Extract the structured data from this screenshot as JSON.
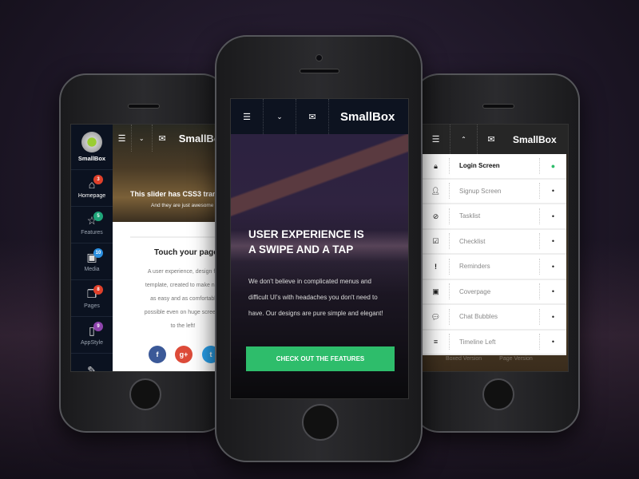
{
  "brand": "SmallBox",
  "left_phone": {
    "header": {
      "menu_icon": "hamburger-icon",
      "dropdown_icon": "chevron-down-icon",
      "mail_icon": "envelope-icon",
      "brand": "SmallBox"
    },
    "sidebar": {
      "logo_label": "SmallBox",
      "items": [
        {
          "label": "Homepage",
          "icon": "home-icon",
          "badge": "3",
          "badge_color": "#e0402a"
        },
        {
          "label": "Features",
          "icon": "star-icon",
          "badge": "5",
          "badge_color": "#1fa67a"
        },
        {
          "label": "Media",
          "icon": "image-icon",
          "badge": "10",
          "badge_color": "#2b8fe0"
        },
        {
          "label": "Pages",
          "icon": "pages-icon",
          "badge": "8",
          "badge_color": "#e0402a"
        },
        {
          "label": "AppStyle",
          "icon": "phone-icon",
          "badge": "9",
          "badge_color": "#8e44ad"
        }
      ]
    },
    "slider": {
      "title": "This slider has CSS3 tran",
      "subtitle": "And they are just awesome"
    },
    "content": {
      "heading": "Touch your page",
      "body": [
        "A user experience, design fo",
        "template, created to make nav",
        "as easy and as comfortabl",
        "possible even on huge screens",
        "to the left!"
      ]
    },
    "social": [
      {
        "label": "f",
        "color": "#3b5998"
      },
      {
        "label": "g+",
        "color": "#dd4b39"
      },
      {
        "label": "t",
        "color": "#2aa1ec"
      }
    ]
  },
  "center_phone": {
    "header": {
      "brand": "SmallBox"
    },
    "hero": {
      "title_line1": "USER EXPERIENCE IS",
      "title_line2": "A SWIPE AND A TAP",
      "body": [
        "We don't believe in complicated menus and",
        "difficult UI's with headaches you don't need to",
        "have. Our designs are pure simple and elegant!"
      ]
    },
    "cta": {
      "label": "CHECK OUT THE FEATURES",
      "color": "#2ebd6b"
    }
  },
  "right_phone": {
    "header": {
      "brand": "SmallBox"
    },
    "menu": [
      {
        "label": "Login Screen",
        "icon": "lock-icon",
        "active": true
      },
      {
        "label": "Signup Screen",
        "icon": "user-icon",
        "active": false
      },
      {
        "label": "Tasklist",
        "icon": "check-circle-icon",
        "active": false
      },
      {
        "label": "Checklist",
        "icon": "checkbox-icon",
        "active": false
      },
      {
        "label": "Reminders",
        "icon": "exclamation-icon",
        "active": false
      },
      {
        "label": "Coverpage",
        "icon": "image-icon",
        "active": false
      },
      {
        "label": "Chat Bubbles",
        "icon": "chat-icon",
        "active": false
      },
      {
        "label": "Timeline Left",
        "icon": "list-icon",
        "active": false
      }
    ],
    "footer": {
      "left": "Boxed Version",
      "right": "Page Version"
    }
  }
}
